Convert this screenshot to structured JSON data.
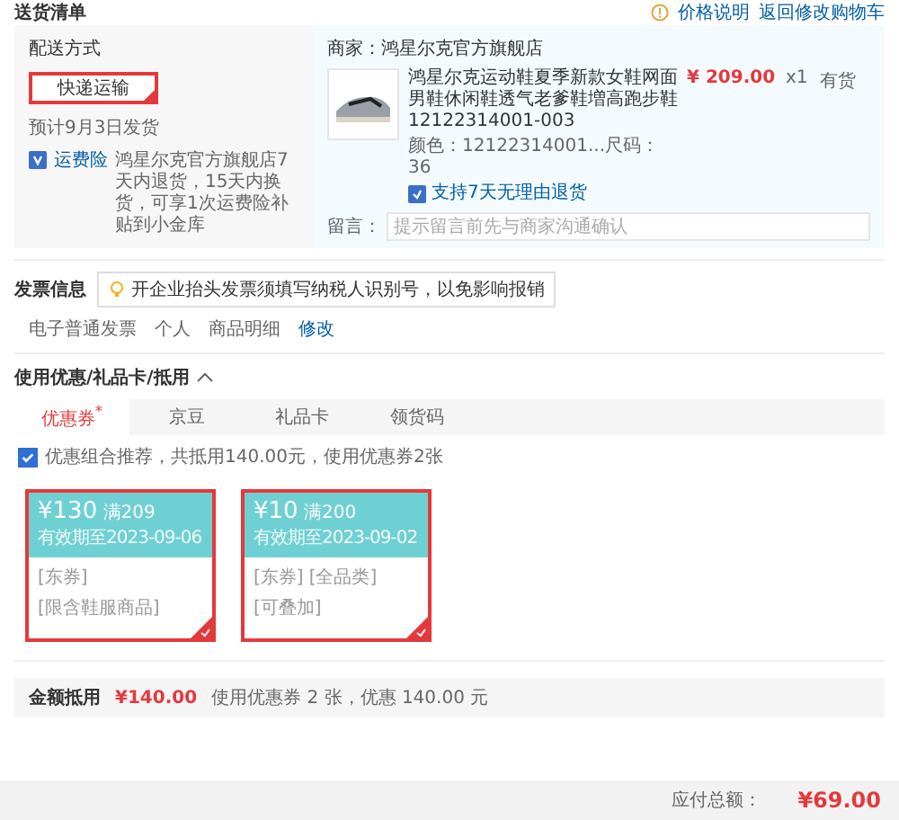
{
  "header": {
    "title": "送货清单",
    "links": [
      {
        "label": "价格说明",
        "kind": "info"
      },
      {
        "label": "返回修改购物车",
        "kind": "plain"
      }
    ]
  },
  "shipping": {
    "label": "配送方式",
    "options": [
      {
        "label": "快递运输",
        "selected": true
      }
    ],
    "estimate": "预计9月3日发货",
    "notice": {
      "tag": "运费险",
      "text": "鸿星尔克官方旗舰店7天内退货，15天内换货，可享1次运费险补贴到小金库"
    }
  },
  "store": {
    "name": "商家：鸿星尔克官方旗舰店",
    "product": {
      "title": "鸿星尔克运动鞋夏季新款女鞋网面男鞋休闲鞋透气老爹鞋増高跑步鞋 12122314001-003",
      "spec": "颜色：12122314001...尺码：36",
      "service": "支持7天无理由退货",
      "price": "¥ 209.00",
      "qty": "x1",
      "stock": "有货"
    },
    "remark": {
      "label": "留言：",
      "placeholder": "提示留言前先与商家沟通确认"
    }
  },
  "invoice": {
    "title": "发票信息",
    "tip": "开企业抬头发票须填写纳税人识别号，以免影响报销",
    "fields": [
      "电子普通发票",
      "个人",
      "商品明细"
    ],
    "edit": "修改"
  },
  "coupons": {
    "title": "使用优惠/礼品卡/抵用",
    "expanded": true,
    "tabs": [
      {
        "label": "优惠券$^{*}$",
        "selected": true
      },
      {
        "label": "京豆",
        "selected": false
      },
      {
        "label": "礼品卡",
        "selected": false
      },
      {
        "label": "领货码",
        "selected": false
      }
    ],
    "auto": {
      "checked": true,
      "text": "优惠组合推荐，共抵用140.00元，使用优惠券2张"
    },
    "items": [
      {
        "amount": "¥130",
        "condition": "满209",
        "validity": "有效期至2023-09-06",
        "tags": [
          "[东券]",
          "[限含鞋服商品]"
        ],
        "selected": true
      },
      {
        "amount": "¥10",
        "condition": "满200",
        "validity": "有效期至2023-09-02",
        "tags": [
          "[东券]",
          "[全品类]",
          "[可叠加]"
        ],
        "selected": true
      }
    ],
    "summary": {
      "label": "金额抵用",
      "amount": "¥140.00",
      "text": "使用优惠券 2 张，优惠 140.00 元"
    }
  },
  "total": {
    "label": "应付总额：",
    "amount": "¥69.00"
  }
}
